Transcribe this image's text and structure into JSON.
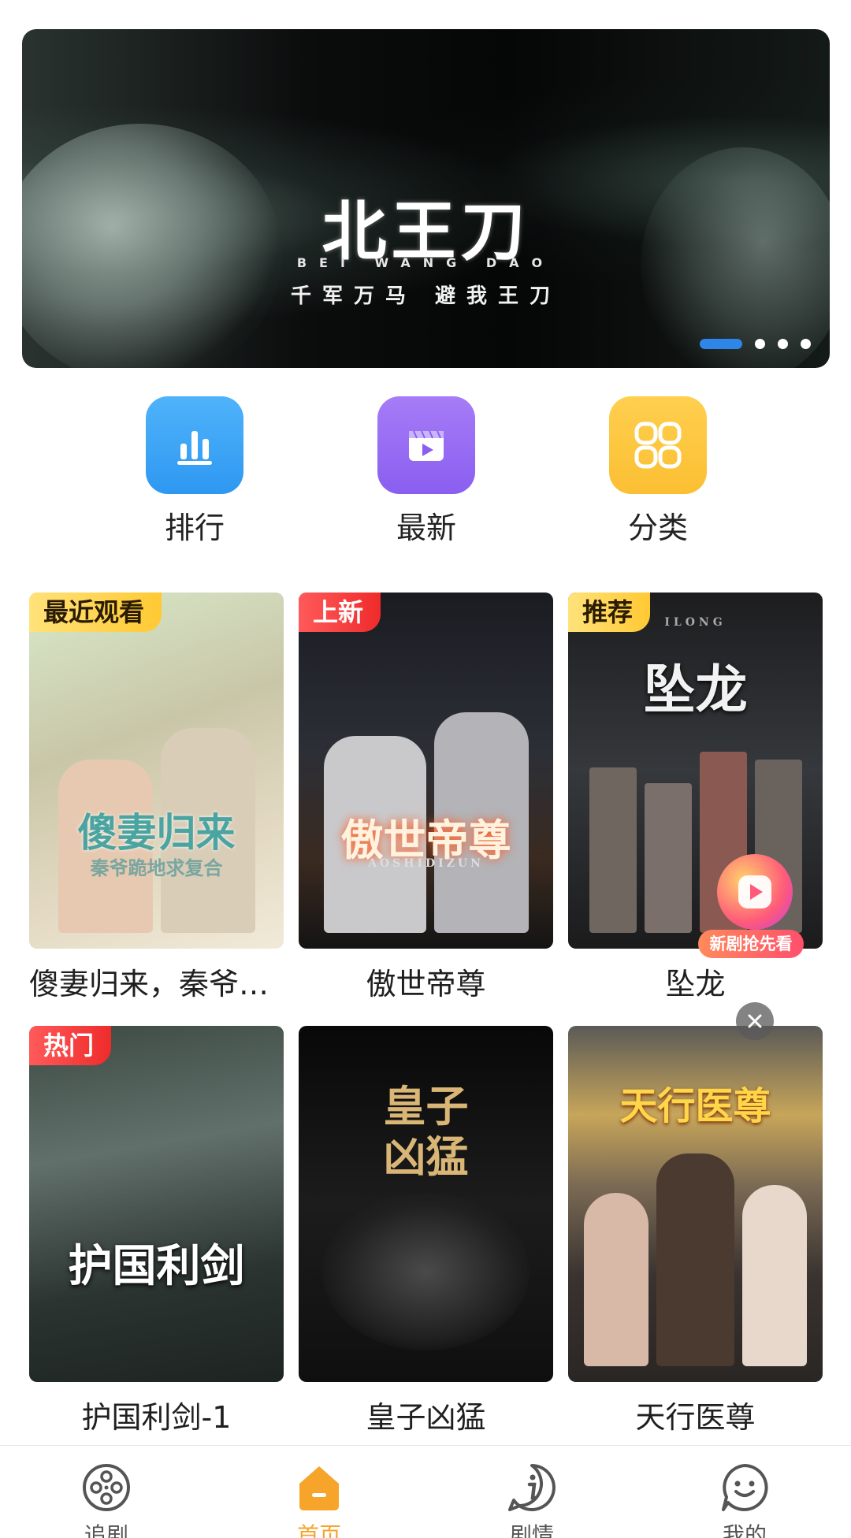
{
  "banner": {
    "title": "北王刀",
    "pinyin": "BEI WANG DAO",
    "slogan": "千军万马  避我王刀",
    "dots": 4,
    "active_dot": 0,
    "accent": "#2d86e8"
  },
  "quick_nav": [
    {
      "label": "排行",
      "icon": "bar-chart-icon",
      "color": "#3aa6f7"
    },
    {
      "label": "最新",
      "icon": "clapper-play-icon",
      "color": "#9a6ef3"
    },
    {
      "label": "分类",
      "icon": "grid-icon",
      "color": "#fdc53e"
    }
  ],
  "grid": [
    {
      "title": "傻妻归来，秦爷…",
      "tag": "最近观看",
      "poster_title": "傻妻归来",
      "poster_subtitle": "秦爷跪地求复合"
    },
    {
      "title": "傲世帝尊",
      "tag": "上新",
      "poster_title": "傲世帝尊",
      "poster_subtitle": "AOSHIDIZUN"
    },
    {
      "title": "坠龙",
      "tag": "推荐",
      "poster_title": "坠龙",
      "poster_subtitle": "ILONG"
    },
    {
      "title": "护国利剑-1",
      "tag": "热门",
      "poster_title": "护国利剑",
      "poster_subtitle": ""
    },
    {
      "title": "皇子凶猛",
      "tag": "",
      "poster_title": "皇子凶猛",
      "poster_subtitle": ""
    },
    {
      "title": "天行医尊",
      "tag": "",
      "poster_title": "天行医尊",
      "poster_subtitle": ""
    }
  ],
  "float_widget": {
    "label": "新剧抢先看"
  },
  "bottom_nav": [
    {
      "label": "追剧",
      "icon": "film-reel-icon",
      "active": false
    },
    {
      "label": "首页",
      "icon": "home-icon",
      "active": true
    },
    {
      "label": "剧情",
      "icon": "info-icon",
      "active": false
    },
    {
      "label": "我的",
      "icon": "smiley-chat-icon",
      "active": false
    }
  ],
  "colors": {
    "active_tab": "#f6a52a",
    "tag_red": "#ef2b2b",
    "tag_yellow": "#ffc933"
  }
}
